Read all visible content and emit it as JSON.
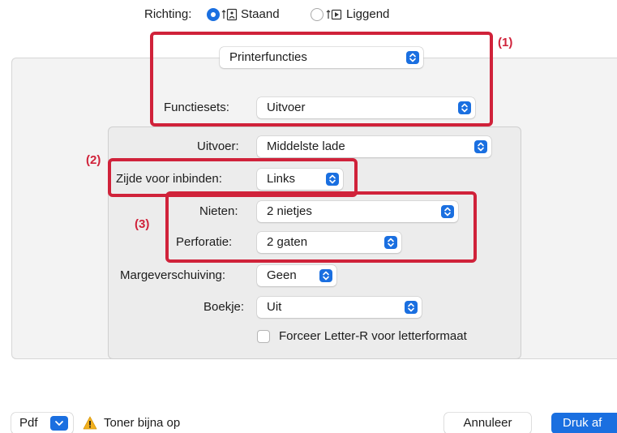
{
  "orientation": {
    "label": "Richting:",
    "options": [
      {
        "label": "Staand",
        "selected": true
      },
      {
        "label": "Liggend",
        "selected": false
      }
    ]
  },
  "printer_menu": {
    "value": "Printerfuncties"
  },
  "feature_sets": {
    "label": "Functiesets:",
    "value": "Uitvoer"
  },
  "settings": {
    "output": {
      "label": "Uitvoer:",
      "value": "Middelste lade"
    },
    "binding_edge": {
      "label": "Zijde voor inbinden:",
      "value": "Links"
    },
    "staple": {
      "label": "Nieten:",
      "value": "2 nietjes"
    },
    "punch": {
      "label": "Perforatie:",
      "value": "2 gaten"
    },
    "margin_shift": {
      "label": "Margeverschuiving:",
      "value": "Geen"
    },
    "booklet": {
      "label": "Boekje:",
      "value": "Uit"
    },
    "force_letter_r": {
      "label": "Forceer Letter-R voor letterformaat",
      "checked": false
    }
  },
  "callouts": {
    "one": "(1)",
    "two": "(2)",
    "three": "(3)"
  },
  "footer": {
    "pdf_label": "Pdf",
    "warning_text": "Toner bijna op",
    "cancel_label": "Annuleer",
    "print_label": "Druk af"
  },
  "colors": {
    "accent": "#1a6fe0",
    "highlight": "#d0223a",
    "warning": "#f2b01e"
  }
}
